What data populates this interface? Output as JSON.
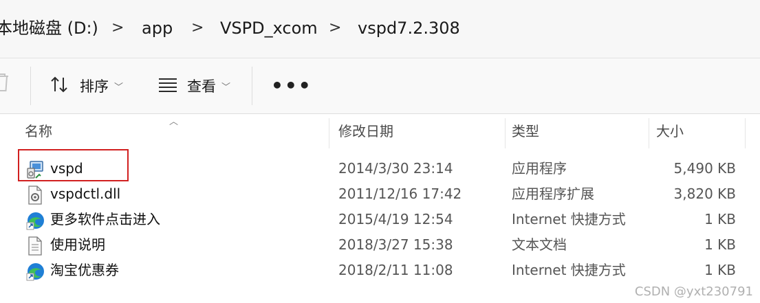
{
  "breadcrumb": {
    "items": [
      "本地磁盘 (D:)",
      "app",
      "VSPD_xcom",
      "vspd7.2.308"
    ],
    "separator": ">"
  },
  "toolbar": {
    "sort_label": "排序",
    "view_label": "查看",
    "more_label": "•••"
  },
  "columns": {
    "name": "名称",
    "modified": "修改日期",
    "type": "类型",
    "size": "大小"
  },
  "files": [
    {
      "name": "vspd",
      "modified": "2014/3/30 23:14",
      "type": "应用程序",
      "size": "5,490 KB",
      "icon": "application-icon"
    },
    {
      "name": "vspdctl.dll",
      "modified": "2011/12/16 17:42",
      "type": "应用程序扩展",
      "size": "3,820 KB",
      "icon": "dll-file-icon"
    },
    {
      "name": "更多软件点击进入",
      "modified": "2015/4/19 12:54",
      "type": "Internet 快捷方式",
      "size": "1 KB",
      "icon": "edge-shortcut-icon"
    },
    {
      "name": "使用说明",
      "modified": "2018/3/27 15:38",
      "type": "文本文档",
      "size": "1 KB",
      "icon": "text-document-icon"
    },
    {
      "name": "淘宝优惠券",
      "modified": "2018/2/11 11:08",
      "type": "Internet 快捷方式",
      "size": "1 KB",
      "icon": "edge-shortcut-icon"
    }
  ],
  "watermark": "CSDN @yxt230791",
  "colors": {
    "highlight_border": "#d11f1f",
    "edge_blue": "#1f7fd6",
    "edge_green": "#3fbf5a"
  }
}
